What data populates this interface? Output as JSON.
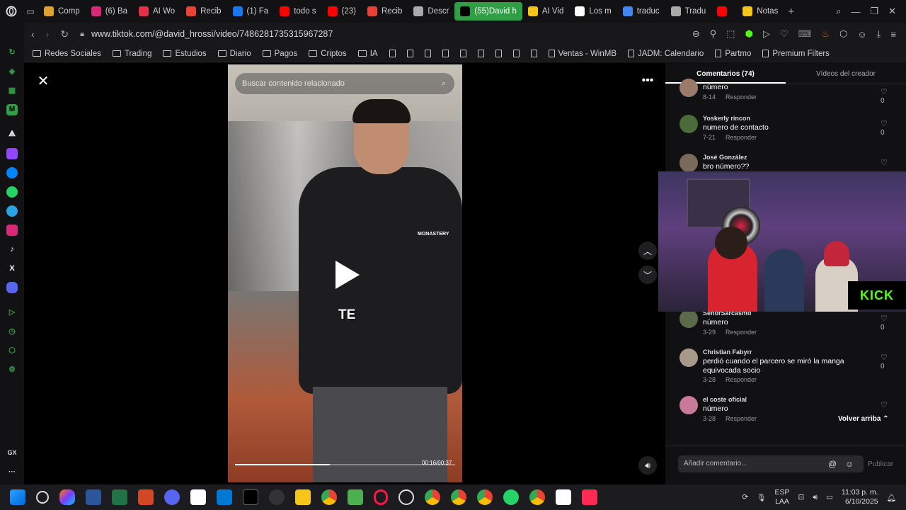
{
  "tabs": [
    {
      "label": "Comp",
      "color": "#e0a030"
    },
    {
      "label": "(6) Ba",
      "color": "#d62976"
    },
    {
      "label": "AI Wo",
      "color": "#e0304a"
    },
    {
      "label": "Recib",
      "color": "#ea4335"
    },
    {
      "label": "(1) Fa",
      "color": "#1877f2"
    },
    {
      "label": "todo s",
      "color": "#ff0000"
    },
    {
      "label": "(23)",
      "color": "#ff0000"
    },
    {
      "label": "Recib",
      "color": "#ea4335"
    },
    {
      "label": "Descr",
      "color": "#aaaaaa"
    },
    {
      "label": "(55)David h",
      "color": "#000000",
      "active": true
    },
    {
      "label": "AI Vid",
      "color": "#f5c518"
    },
    {
      "label": "Los m",
      "color": "#ffffff"
    },
    {
      "label": "traduc",
      "color": "#4285f4"
    },
    {
      "label": "Tradu",
      "color": "#aaaaaa"
    },
    {
      "label": "",
      "color": "#ff0000"
    },
    {
      "label": "Notas",
      "color": "#f5c518"
    }
  ],
  "address": {
    "url": "www.tiktok.com/@david_hrossi/video/7486281735315967287"
  },
  "bookmarks": [
    {
      "label": "Redes Sociales",
      "type": "folder"
    },
    {
      "label": "Trading",
      "type": "folder"
    },
    {
      "label": "Estudios",
      "type": "folder"
    },
    {
      "label": "Diario",
      "type": "folder"
    },
    {
      "label": "Pagos",
      "type": "folder"
    },
    {
      "label": "Criptos",
      "type": "folder"
    },
    {
      "label": "IA",
      "type": "folder"
    },
    {
      "label": "",
      "type": "doc"
    },
    {
      "label": "",
      "type": "doc"
    },
    {
      "label": "",
      "type": "doc"
    },
    {
      "label": "",
      "type": "doc"
    },
    {
      "label": "",
      "type": "doc"
    },
    {
      "label": "",
      "type": "doc"
    },
    {
      "label": "",
      "type": "doc"
    },
    {
      "label": "",
      "type": "doc"
    },
    {
      "label": "",
      "type": "doc"
    },
    {
      "label": "Ventas - WinMB",
      "type": "doc"
    },
    {
      "label": "JADM: Calendario",
      "type": "doc"
    },
    {
      "label": "Partmo",
      "type": "doc"
    },
    {
      "label": "Premium Filters",
      "type": "doc"
    }
  ],
  "video": {
    "search_placeholder": "Buscar contenido relacionado",
    "brand_text": "MONASTERY",
    "caption": "TE",
    "time": "00:16/00:37",
    "progress": 0.43
  },
  "comments_panel": {
    "tab_comments": "Comentarios (74)",
    "tab_videos": "Vídeos del creador",
    "reply_label": "Responder",
    "back_to_top": "Volver arriba",
    "add_placeholder": "Añadir comentario...",
    "publish_label": "Publicar",
    "items": [
      {
        "user": "",
        "text": "número",
        "date": "8-14",
        "likes": "0"
      },
      {
        "user": "Yoskerly rincon",
        "text": "numero de contacto",
        "date": "7-21",
        "likes": "0"
      },
      {
        "user": "José González",
        "text": "bro número??",
        "date": "",
        "likes": ""
      },
      {
        "user": "SeñorSarcasmo",
        "text": "número",
        "date": "3-29",
        "likes": "0"
      },
      {
        "user": "Christian Fabyrr",
        "text": "perdió cuando el parcero se miró la manga equivocada socio",
        "date": "3-28",
        "likes": "0"
      },
      {
        "user": "el coste oficial",
        "text": "número",
        "date": "3-28",
        "likes": ""
      }
    ]
  },
  "overlay": {
    "kick_label": "KICK"
  },
  "taskbar": {
    "lang_top": "ESP",
    "lang_bottom": "LAA",
    "time": "11:03 p. m.",
    "date": "6/10/2025"
  },
  "sidebar_label": "GX"
}
